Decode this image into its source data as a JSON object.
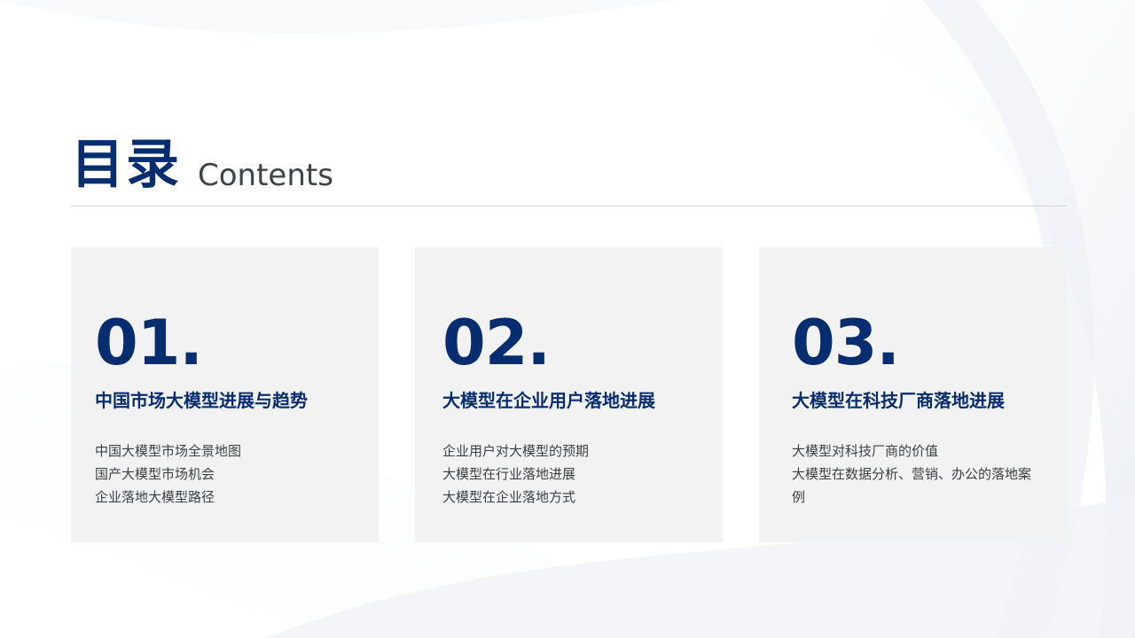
{
  "header": {
    "title": "目录",
    "subtitle": "Contents"
  },
  "cards": [
    {
      "number": "01.",
      "title": "中国市场大模型进展与趋势",
      "items": [
        "中国大模型市场全景地图",
        "国产大模型市场机会",
        "企业落地大模型路径"
      ]
    },
    {
      "number": "02.",
      "title": "大模型在企业用户落地进展",
      "items": [
        "企业用户对大模型的预期",
        "大模型在行业落地进展",
        "大模型在企业落地方式"
      ]
    },
    {
      "number": "03.",
      "title": "大模型在科技厂商落地进展",
      "items": [
        "大模型对科技厂商的价值",
        "大模型在数据分析、营销、办公的落地案",
        "例"
      ]
    }
  ],
  "colors": {
    "accent": "#062d6f",
    "card_bg": "#f2f2f3",
    "text": "#3c3f43"
  }
}
